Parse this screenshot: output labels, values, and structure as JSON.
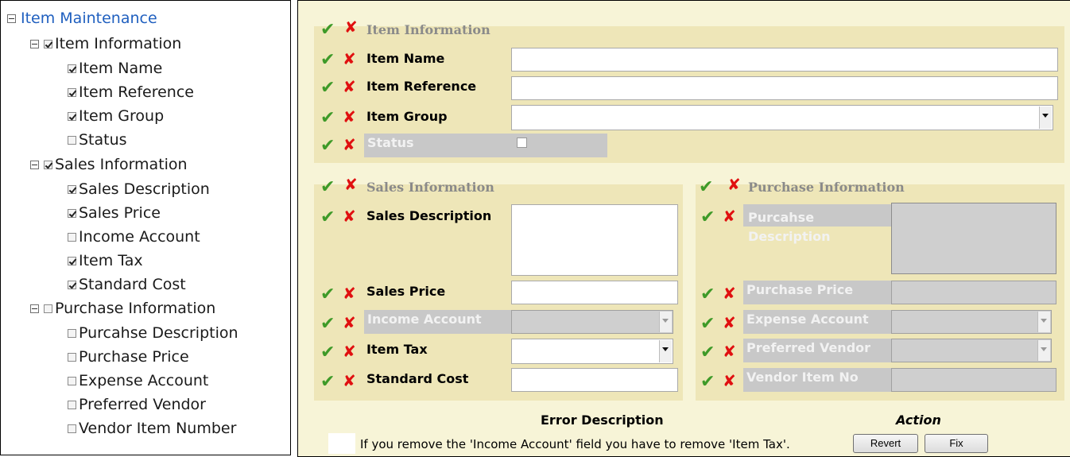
{
  "tree": {
    "root_label": "Item Maintenance",
    "groups": [
      {
        "label": "Item Information",
        "checked": true,
        "items": [
          {
            "label": "Item Name",
            "checked": true
          },
          {
            "label": "Item Reference",
            "checked": true
          },
          {
            "label": "Item Group",
            "checked": true
          },
          {
            "label": "Status",
            "checked": false
          }
        ]
      },
      {
        "label": "Sales Information",
        "checked": true,
        "items": [
          {
            "label": "Sales Description",
            "checked": true
          },
          {
            "label": "Sales Price",
            "checked": true
          },
          {
            "label": "Income Account",
            "checked": false
          },
          {
            "label": "Item Tax",
            "checked": true
          },
          {
            "label": "Standard Cost",
            "checked": true
          }
        ]
      },
      {
        "label": "Purchase Information",
        "checked": false,
        "items": [
          {
            "label": "Purcahse Description",
            "checked": false
          },
          {
            "label": "Purchase Price",
            "checked": false
          },
          {
            "label": "Expense Account",
            "checked": false
          },
          {
            "label": "Preferred Vendor",
            "checked": false
          },
          {
            "label": "Vendor Item Number",
            "checked": false
          }
        ]
      }
    ]
  },
  "form": {
    "item_info": {
      "legend": "Item Information",
      "item_name": "Item Name",
      "item_reference": "Item Reference",
      "item_group": "Item Group",
      "status": "Status"
    },
    "sales_info": {
      "legend": "Sales Information",
      "sales_description": "Sales Description",
      "sales_price": "Sales Price",
      "income_account": "Income Account",
      "item_tax": "Item Tax",
      "standard_cost": "Standard Cost"
    },
    "purchase_info": {
      "legend": "Purchase Information",
      "purchase_description": "Purcahse Description",
      "purchase_price": "Purchase Price",
      "expense_account": "Expense Account",
      "preferred_vendor": "Preferred Vendor",
      "vendor_item_no": "Vendor Item No"
    }
  },
  "errors": {
    "title": "Error Description",
    "action_title": "Action",
    "message": "If you remove the 'Income Account' field you have to remove 'Item Tax'.",
    "revert_label": "Revert",
    "fix_label": "Fix"
  },
  "icons": {
    "accept": "check-icon",
    "reject": "cross-icon"
  },
  "colors": {
    "accept": "#3e9a28",
    "reject": "#e01010",
    "panel": "#f7f4d7",
    "group": "#eee6b8",
    "tree_root": "#1f5fbf"
  }
}
